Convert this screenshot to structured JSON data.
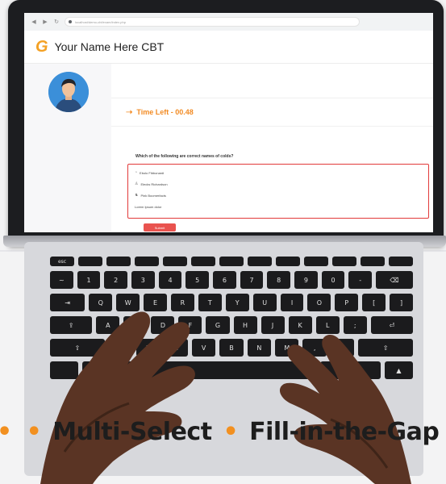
{
  "browser": {
    "url": "localhost/demo-cbt/exam/index.php"
  },
  "app": {
    "logo_letter": "G",
    "title": "Your Name Here CBT"
  },
  "timer": {
    "label": "Time Left - 00.48"
  },
  "question": {
    "text": "Which of the following are correct names of colds?"
  },
  "options": [
    {
      "label": "Ebolo  Fibbonardi"
    },
    {
      "label": "Elecks  Richardson"
    },
    {
      "label": "Pink  Boomerfacts"
    },
    {
      "label": "Lorem  Ipsum dolor"
    }
  ],
  "submit_label": "Submit",
  "caption": {
    "items": [
      "Multi-Select",
      "Fill-in-the-Gap"
    ]
  },
  "colors": {
    "accent": "#f28b24",
    "danger": "#e23a3a",
    "avatar": "#3b8fd9"
  }
}
